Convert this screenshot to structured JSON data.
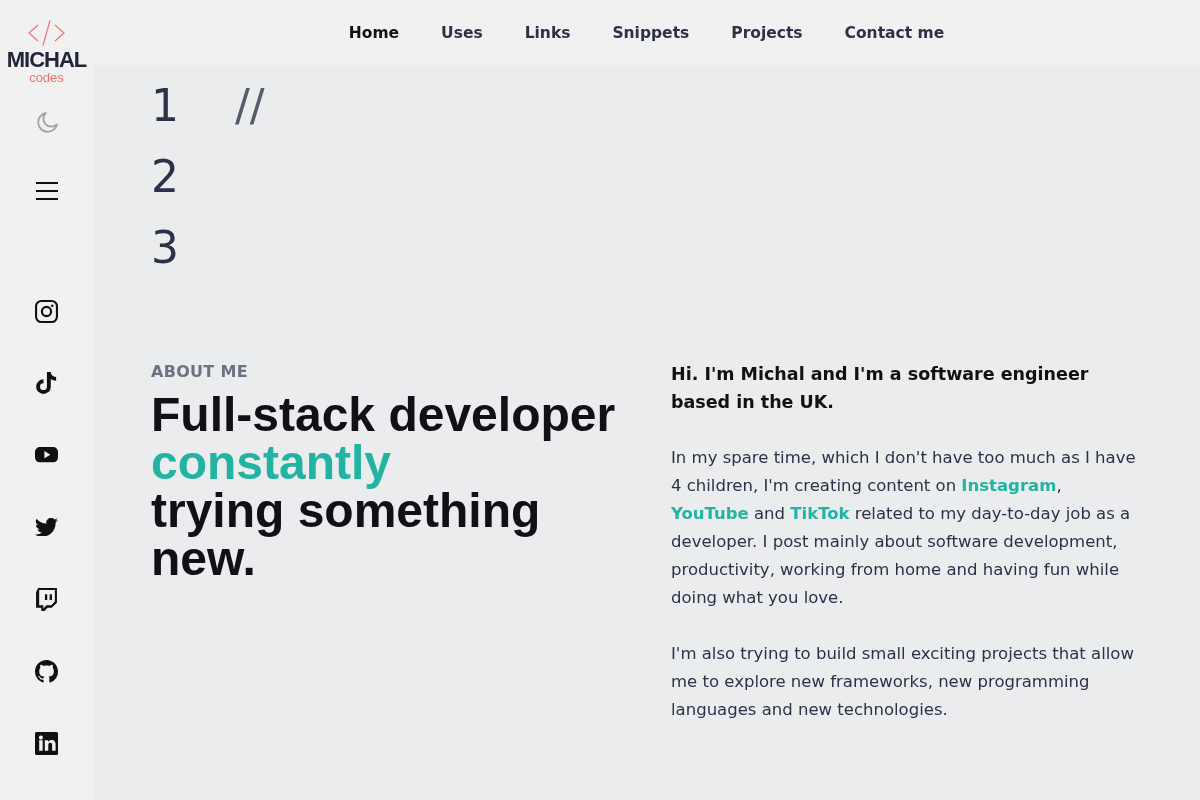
{
  "logo": {
    "name": "MICHAL",
    "tagline": "codes"
  },
  "nav": [
    {
      "label": "Home",
      "selected": true
    },
    {
      "label": "Uses",
      "selected": false
    },
    {
      "label": "Links",
      "selected": false
    },
    {
      "label": "Snippets",
      "selected": false
    },
    {
      "label": "Projects",
      "selected": false
    },
    {
      "label": "Contact me",
      "selected": false
    }
  ],
  "code": {
    "lines": [
      {
        "number": "1",
        "text": "//"
      },
      {
        "number": "2"
      },
      {
        "number": "3"
      }
    ]
  },
  "about": {
    "label": "ABOUT ME",
    "headline": [
      {
        "kind": "plain",
        "text": "Full-stack developer"
      },
      {
        "kind": "accent",
        "text": "constantly"
      },
      {
        "kind": "plain",
        "text": "trying something new."
      }
    ],
    "intro": "Hi. I'm Michal and I'm a software engineer based in the UK.",
    "paragraphs": [
      {
        "parts": [
          {
            "kind": "text",
            "text": "In my spare time, which I don't have too much as I have 4 children, I'm creating content on "
          },
          {
            "kind": "link",
            "text": "Instagram"
          },
          {
            "kind": "text",
            "text": ", "
          },
          {
            "kind": "link",
            "text": "YouTube"
          },
          {
            "kind": "text",
            "text": " and "
          },
          {
            "kind": "link",
            "text": "TikTok"
          },
          {
            "kind": "text",
            "text": " related to my day-to-day job as a developer. I post mainly about software development, productivity, working from home and having fun while doing what you love."
          }
        ]
      },
      {
        "parts": [
          {
            "kind": "text",
            "text": "I'm also trying to build small exciting projects that allow me to explore new frameworks, new programming languages and new technologies."
          }
        ]
      }
    ]
  }
}
